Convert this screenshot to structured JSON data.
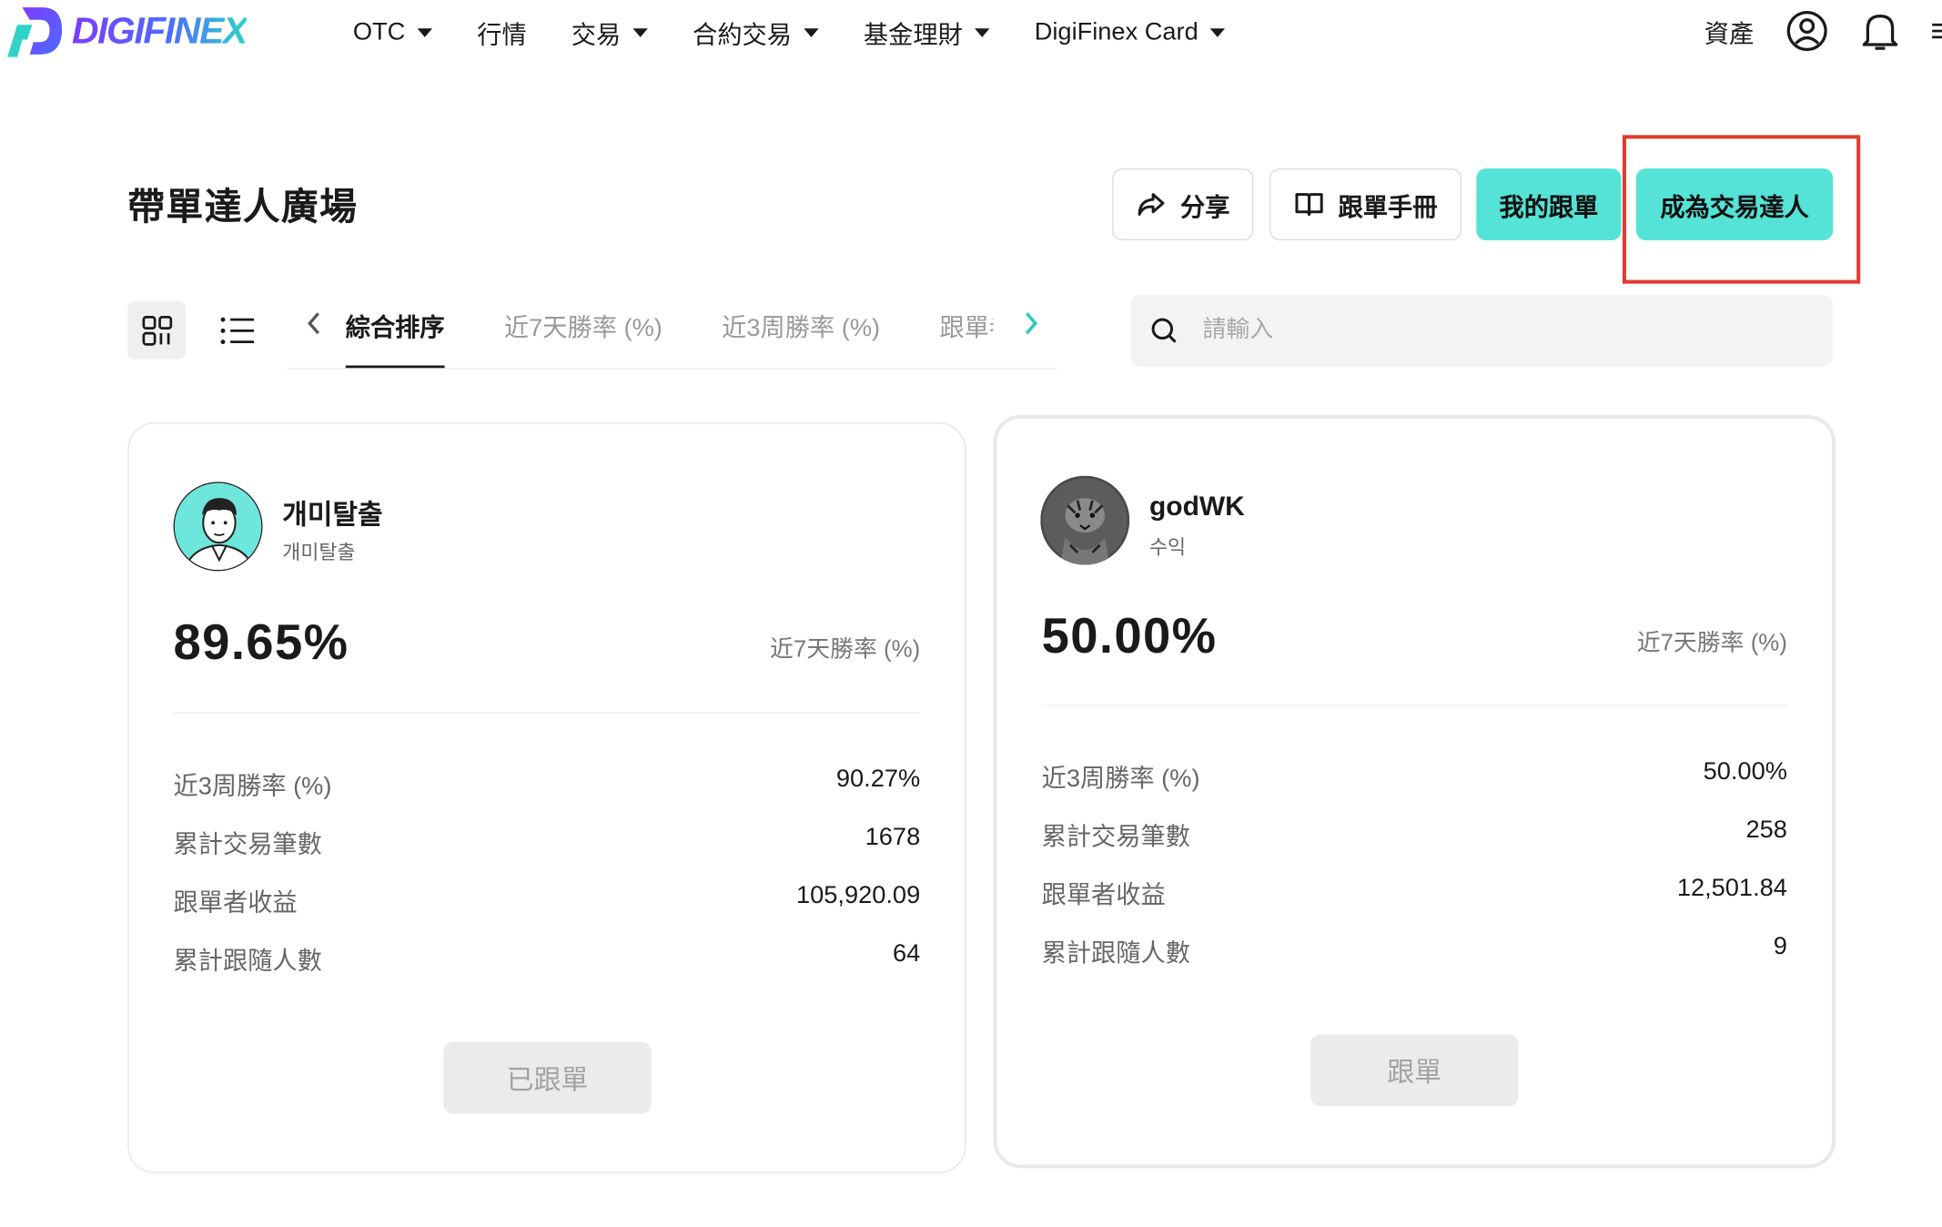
{
  "brand": {
    "name": "DIGIFINEX",
    "gradient_start": "#7c3cff",
    "gradient_end": "#2fd3c9"
  },
  "nav": {
    "items": [
      {
        "label": "OTC",
        "has_dropdown": true
      },
      {
        "label": "行情",
        "has_dropdown": false
      },
      {
        "label": "交易",
        "has_dropdown": true
      },
      {
        "label": "合約交易",
        "has_dropdown": true
      },
      {
        "label": "基金理財",
        "has_dropdown": true
      },
      {
        "label": "DigiFinex Card",
        "has_dropdown": true
      }
    ],
    "assets_label": "資產",
    "icons": [
      "user-icon",
      "bell-icon",
      "menu-icon"
    ]
  },
  "page": {
    "title": "帶單達人廣場",
    "actions": {
      "share": "分享",
      "manual": "跟單手冊",
      "my_follows": "我的跟單",
      "become_trader": "成為交易達人"
    },
    "accent_color": "#54e3d6",
    "highlight_color": "#e23c2e"
  },
  "filters": {
    "tabs": [
      {
        "label": "綜合排序",
        "active": true
      },
      {
        "label": "近7天勝率 (%)",
        "active": false
      },
      {
        "label": "近3周勝率 (%)",
        "active": false
      },
      {
        "label": "跟單者收益",
        "active": false
      }
    ],
    "search_placeholder": "請輸入",
    "view_modes": [
      "grid-view",
      "list-view"
    ]
  },
  "traders": [
    {
      "name": "개미탈출",
      "subtitle": "개미탈출",
      "win_rate_7d": "89.65%",
      "win_rate_7d_label": "近7天勝率 (%)",
      "stats": [
        {
          "label": "近3周勝率 (%)",
          "value": "90.27%"
        },
        {
          "label": "累計交易筆數",
          "value": "1678"
        },
        {
          "label": "跟單者收益",
          "value": "105,920.09"
        },
        {
          "label": "累計跟隨人數",
          "value": "64"
        }
      ],
      "button_label": "已跟單"
    },
    {
      "name": "godWK",
      "subtitle": "수익",
      "win_rate_7d": "50.00%",
      "win_rate_7d_label": "近7天勝率 (%)",
      "stats": [
        {
          "label": "近3周勝率 (%)",
          "value": "50.00%"
        },
        {
          "label": "累計交易筆數",
          "value": "258"
        },
        {
          "label": "跟單者收益",
          "value": "12,501.84"
        },
        {
          "label": "累計跟隨人數",
          "value": "9"
        }
      ],
      "button_label": "跟單"
    }
  ]
}
